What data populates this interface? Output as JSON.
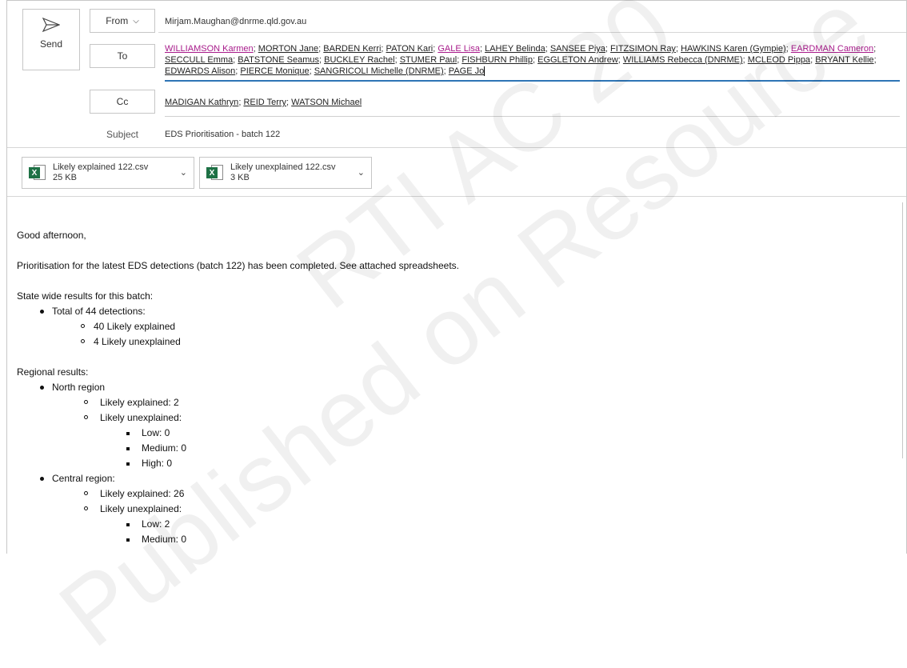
{
  "compose": {
    "send_label": "Send",
    "from_label": "From",
    "from_value": "Mirjam.Maughan@dnrme.qld.gov.au",
    "to_label": "To",
    "to_recipients": [
      {
        "name": "WILLIAMSON Karmen",
        "visited": true
      },
      {
        "name": "MORTON Jane",
        "visited": false
      },
      {
        "name": "BARDEN Kerri",
        "visited": false
      },
      {
        "name": "PATON Kari",
        "visited": false
      },
      {
        "name": "GALE Lisa",
        "visited": true
      },
      {
        "name": "LAHEY Belinda",
        "visited": false
      },
      {
        "name": "SANSEE Piya",
        "visited": false
      },
      {
        "name": "FITZSIMON Ray",
        "visited": false
      },
      {
        "name": "HAWKINS Karen (Gympie)",
        "visited": false
      },
      {
        "name": "EARDMAN Cameron",
        "visited": true
      },
      {
        "name": "SECCULL Emma",
        "visited": false
      },
      {
        "name": "BATSTONE Seamus",
        "visited": false
      },
      {
        "name": "BUCKLEY Rachel",
        "visited": false
      },
      {
        "name": "STUMER Paul",
        "visited": false
      },
      {
        "name": "FISHBURN Phillip",
        "visited": false
      },
      {
        "name": "EGGLETON Andrew",
        "visited": false
      },
      {
        "name": "WILLIAMS Rebecca (DNRME)",
        "visited": false
      },
      {
        "name": "MCLEOD Pippa",
        "visited": false
      },
      {
        "name": "BRYANT Kellie",
        "visited": false
      },
      {
        "name": "EDWARDS Alison",
        "visited": false
      },
      {
        "name": "PIERCE Monique",
        "visited": false
      },
      {
        "name": "SANGRICOLI Michelle (DNRME)",
        "visited": false
      },
      {
        "name": "PAGE Jo",
        "visited": false
      }
    ],
    "cc_label": "Cc",
    "cc_recipients": [
      "MADIGAN Kathryn",
      "REID Terry",
      "WATSON Michael"
    ],
    "subject_label": "Subject",
    "subject_value": "EDS Prioritisation - batch 122"
  },
  "attachments": [
    {
      "name": "Likely explained 122.csv",
      "size": "25 KB"
    },
    {
      "name": "Likely unexplained 122.csv",
      "size": "3 KB"
    }
  ],
  "message": {
    "greeting": "Good afternoon,",
    "intro": "Prioritisation for the latest EDS detections (batch 122) has been completed.  See attached spreadsheets.",
    "state_heading": "State wide results for this batch:",
    "state_total": "Total of  44 detections:",
    "state_explained": "40 Likely explained",
    "state_unexplained": "4 Likely unexplained",
    "regional_heading": "Regional results:",
    "north": {
      "name": "North region",
      "explained": "Likely explained: 2",
      "unexplained": "Likely unexplained:",
      "low": "Low: 0",
      "medium": "Medium: 0",
      "high": "High: 0"
    },
    "central": {
      "name": "Central region:",
      "explained": "Likely explained: 26",
      "unexplained": "Likely unexplained:",
      "low": "Low: 2",
      "medium": "Medium: 0"
    }
  },
  "watermark": {
    "line1": "Published on Resource",
    "line2": "RTI AC 20"
  },
  "colors": {
    "visited_link": "#a71a8a",
    "excel_green": "#1e7145",
    "focus_underline": "#2e75b6"
  }
}
